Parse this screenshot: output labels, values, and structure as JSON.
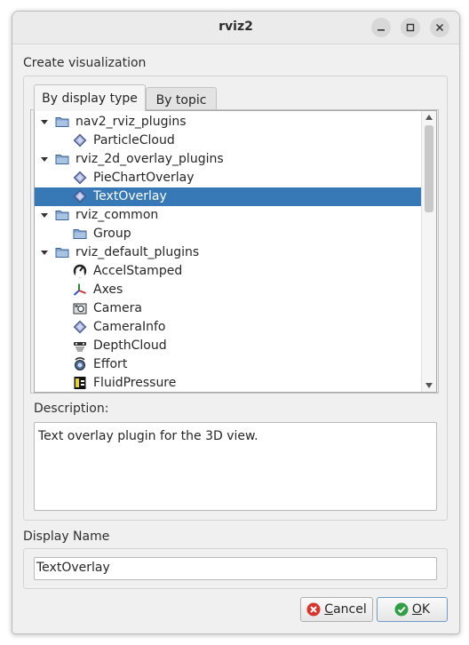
{
  "window": {
    "title": "rviz2"
  },
  "create_visualization": {
    "label": "Create visualization",
    "tabs": [
      {
        "label": "By display type",
        "active": true
      },
      {
        "label": "By topic",
        "active": false
      }
    ],
    "tree": [
      {
        "label": "nav2_rviz_plugins",
        "level": 0,
        "icon": "folder-icon",
        "expanded": true
      },
      {
        "label": "ParticleCloud",
        "level": 1,
        "icon": "plugin-diamond-icon"
      },
      {
        "label": "rviz_2d_overlay_plugins",
        "level": 0,
        "icon": "folder-icon",
        "expanded": true
      },
      {
        "label": "PieChartOverlay",
        "level": 1,
        "icon": "plugin-diamond-icon"
      },
      {
        "label": "TextOverlay",
        "level": 1,
        "icon": "plugin-diamond-icon",
        "selected": true
      },
      {
        "label": "rviz_common",
        "level": 0,
        "icon": "folder-icon",
        "expanded": true
      },
      {
        "label": "Group",
        "level": 1,
        "icon": "folder-icon"
      },
      {
        "label": "rviz_default_plugins",
        "level": 0,
        "icon": "folder-icon",
        "expanded": true
      },
      {
        "label": "AccelStamped",
        "level": 1,
        "icon": "accel-icon"
      },
      {
        "label": "Axes",
        "level": 1,
        "icon": "axes-icon"
      },
      {
        "label": "Camera",
        "level": 1,
        "icon": "camera-icon"
      },
      {
        "label": "CameraInfo",
        "level": 1,
        "icon": "plugin-diamond-icon"
      },
      {
        "label": "DepthCloud",
        "level": 1,
        "icon": "depth-cloud-icon"
      },
      {
        "label": "Effort",
        "level": 1,
        "icon": "effort-icon"
      },
      {
        "label": "FluidPressure",
        "level": 1,
        "icon": "fluid-pressure-icon"
      }
    ]
  },
  "description": {
    "label": "Description:",
    "text": "Text overlay plugin for the 3D view."
  },
  "display_name": {
    "label": "Display Name",
    "value": "TextOverlay"
  },
  "buttons": {
    "cancel": {
      "label_underlined": "C",
      "label_rest": "ancel"
    },
    "ok": {
      "label_underlined": "O",
      "label_rest": "K"
    }
  },
  "colors": {
    "selection": "#3778b6",
    "folder": "#4a74a8",
    "cancel_icon": "#d9342b",
    "ok_icon": "#2f9e44"
  }
}
